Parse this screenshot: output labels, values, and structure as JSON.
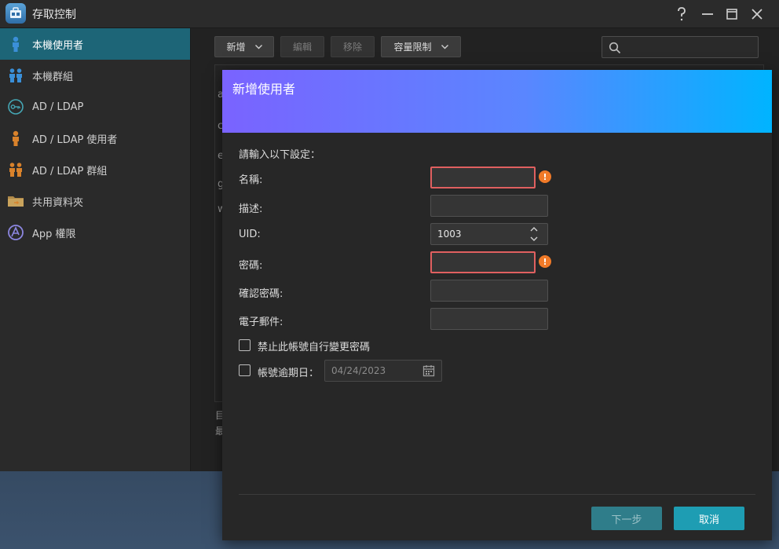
{
  "window": {
    "title": "存取控制",
    "controls": {
      "help": "help-icon",
      "minimize": "minimize-icon",
      "maximize": "maximize-icon",
      "close": "close-icon"
    }
  },
  "sidebar": {
    "items": [
      {
        "label": "本機使用者",
        "icon": "user-icon",
        "active": true
      },
      {
        "label": "本機群組",
        "icon": "group-icon",
        "active": false
      },
      {
        "label": "AD / LDAP",
        "icon": "key-icon",
        "active": false
      },
      {
        "label": "AD / LDAP 使用者",
        "icon": "user-icon",
        "active": false
      },
      {
        "label": "AD / LDAP 群組",
        "icon": "group-icon",
        "active": false
      },
      {
        "label": "共用資料夾",
        "icon": "folder-icon",
        "active": false
      },
      {
        "label": "App 權限",
        "icon": "app-icon",
        "active": false
      }
    ]
  },
  "toolbar": {
    "add": "新增",
    "edit": "編輯",
    "remove": "移除",
    "quota": "容量限制",
    "search_placeholder": ""
  },
  "background_list": {
    "row_initials": [
      "a",
      "c",
      "e",
      "g",
      "w"
    ],
    "footer_lines": [
      "目",
      "最"
    ]
  },
  "dialog": {
    "title": "新增使用者",
    "intro": "請輸入以下設定：",
    "fields": {
      "name_label": "名稱:",
      "description_label": "描述:",
      "uid_label": "UID:",
      "uid_value": "1003",
      "password_label": "密碼:",
      "confirm_label": "確認密碼:",
      "email_label": "電子郵件:"
    },
    "warning_glyph": "!",
    "options": {
      "no_change_pw": "禁止此帳號自行變更密碼",
      "expiry_label": "帳號逾期日：",
      "expiry_date": "04/24/2023"
    },
    "buttons": {
      "next": "下一步",
      "cancel": "取消"
    }
  },
  "colors": {
    "accent": "#1d6577",
    "header_gradient_start": "#7a63ff",
    "header_gradient_end": "#00b4ff",
    "error_border": "#e06060",
    "warning": "#f07a28",
    "cancel_button": "#1e9db3"
  }
}
